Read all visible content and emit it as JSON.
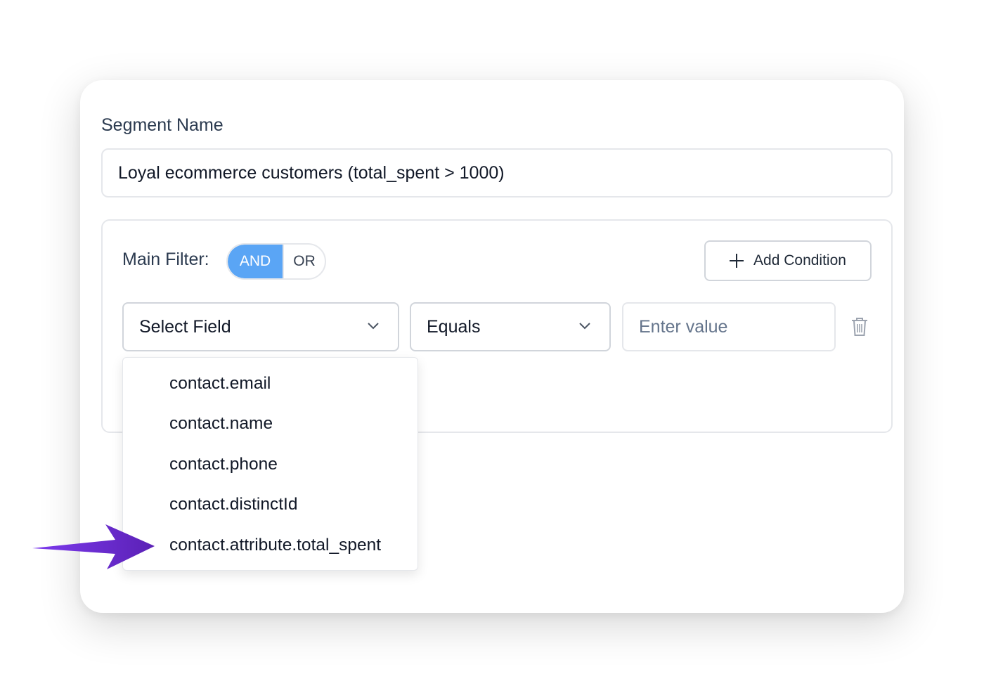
{
  "segment": {
    "label": "Segment Name",
    "value": "Loyal ecommerce customers (total_spent > 1000)"
  },
  "filter": {
    "label": "Main Filter:",
    "toggle": {
      "and_label": "AND",
      "or_label": "OR",
      "selected": "AND"
    },
    "add_condition_label": "Add Condition",
    "condition": {
      "field_placeholder": "Select Field",
      "operator": "Equals",
      "value_placeholder": "Enter value"
    }
  },
  "dropdown": {
    "items": [
      {
        "label": "contact.email"
      },
      {
        "label": "contact.name"
      },
      {
        "label": "contact.phone"
      },
      {
        "label": "contact.distinctId"
      },
      {
        "label": "contact.attribute.total_spent"
      }
    ],
    "highlighted_index": 4
  },
  "colors": {
    "toggle_active": "#5aa5f5",
    "arrow": "#5b21b6"
  },
  "icons": {
    "add": "plus-icon",
    "select": "chevron-down-icon",
    "delete": "trash-icon",
    "annotation": "arrow-icon"
  }
}
